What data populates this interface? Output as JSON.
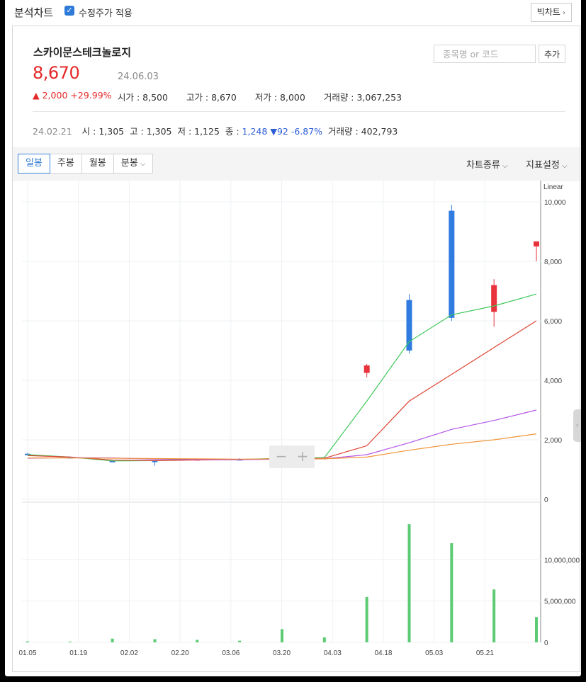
{
  "app": {
    "title": "분석차트",
    "adjusted_label": "수정주가 적용",
    "big_chart_label": "빅차트"
  },
  "stock": {
    "name": "스카이문스테크놀로지",
    "price": "8,670",
    "date": "24.06.03",
    "change_arrow": "▲",
    "change": "2,000",
    "change_pct": "+29.99%",
    "open": "시가 : 8,500",
    "high": "고가 : 8,670",
    "low": "저가 : 8,000",
    "volume": "거래량 : 3,067,253"
  },
  "search": {
    "placeholder": "종목명 or 코드",
    "add_label": "추가"
  },
  "prev_day": {
    "date": "24.02.21",
    "open": "시 : 1,305",
    "high": "고 : 1,305",
    "low": "저 : 1,125",
    "close_label": "종 :",
    "close": "1,248",
    "change": "▼92 -6.87%",
    "volume": "거래량 : 402,793"
  },
  "tabs": [
    "일봉",
    "주봉",
    "월봉",
    "분봉"
  ],
  "active_tab": "일봉",
  "toolbar_right": {
    "chart_type": "차트종류",
    "indicators": "지표설정"
  },
  "chevron_icon": "chevron-down-icon",
  "colors": {
    "up": "#e8323c",
    "down": "#2f7be0",
    "ma5": "#3ec85a",
    "ma20": "#dd4433",
    "ma60": "#b455e6",
    "ma120": "#f2953a",
    "volume": "#5ccb74"
  },
  "chart_data": [
    {
      "type": "candlestick",
      "scale": "Linear",
      "ylim": [
        0,
        10000
      ],
      "yticks": [
        "0",
        "2,000",
        "4,000",
        "6,000",
        "8,000",
        "10,000"
      ],
      "xticks": [
        "01.05",
        "01.19",
        "02.02",
        "02.20",
        "03.06",
        "03.20",
        "04.03",
        "04.18",
        "05.03",
        "05.21"
      ],
      "grid": true,
      "series": [
        {
          "name": "가격",
          "days": [
            {
              "x": "01.05",
              "o": 1530,
              "h": 1560,
              "l": 1490,
              "c": 1500
            },
            {
              "x": "01.19",
              "o": 1420,
              "h": 1440,
              "l": 1370,
              "c": 1390
            },
            {
              "x": "02.02",
              "o": 1290,
              "h": 1320,
              "l": 1260,
              "c": 1280
            },
            {
              "x": "02.20",
              "o": 1305,
              "h": 1305,
              "l": 1125,
              "c": 1248
            },
            {
              "x": "03.06",
              "o": 1340,
              "h": 1360,
              "l": 1320,
              "c": 1350
            },
            {
              "x": "03.20",
              "o": 1350,
              "h": 1380,
              "l": 1310,
              "c": 1330
            },
            {
              "x": "04.03",
              "o": 1380,
              "h": 1450,
              "l": 1360,
              "c": 1420
            },
            {
              "x": "04.18",
              "o": 1370,
              "h": 1420,
              "l": 1340,
              "c": 1400
            },
            {
              "x": "05.03",
              "o": 4250,
              "h": 4550,
              "l": 4100,
              "c": 4500
            },
            {
              "x": "05.13",
              "o": 6700,
              "h": 6900,
              "l": 4900,
              "c": 5000
            },
            {
              "x": "05.21",
              "o": 9700,
              "h": 9900,
              "l": 6000,
              "c": 6100
            },
            {
              "x": "05.29",
              "o": 6300,
              "h": 7400,
              "l": 5800,
              "c": 7200
            },
            {
              "x": "06.03",
              "o": 8500,
              "h": 8670,
              "l": 8000,
              "c": 8670
            }
          ]
        },
        {
          "name": "MA5",
          "values": [
            1500,
            1420,
            1290,
            1300,
            1340,
            1340,
            1380,
            1400,
            3300,
            5300,
            6200,
            6500,
            6900
          ]
        },
        {
          "name": "MA20",
          "values": [
            1470,
            1420,
            1320,
            1300,
            1320,
            1330,
            1370,
            1380,
            1800,
            3300,
            4200,
            5100,
            6000
          ]
        },
        {
          "name": "MA60",
          "values": [
            1380,
            1400,
            1390,
            1350,
            1340,
            1330,
            1350,
            1360,
            1500,
            1900,
            2350,
            2650,
            3000
          ]
        },
        {
          "name": "MA120",
          "values": [
            1390,
            1390,
            1380,
            1370,
            1360,
            1350,
            1360,
            1360,
            1420,
            1650,
            1850,
            2000,
            2200
          ]
        }
      ]
    },
    {
      "type": "bar",
      "ylim": [
        0,
        15000000
      ],
      "yticks": [
        "0",
        "5,000,000",
        "10,000,000"
      ],
      "series": [
        {
          "name": "거래량",
          "values": [
            120000,
            90000,
            450000,
            380000,
            300000,
            200000,
            1600000,
            600000,
            5500000,
            14300000,
            12000000,
            6400000,
            3067253
          ]
        }
      ]
    }
  ]
}
